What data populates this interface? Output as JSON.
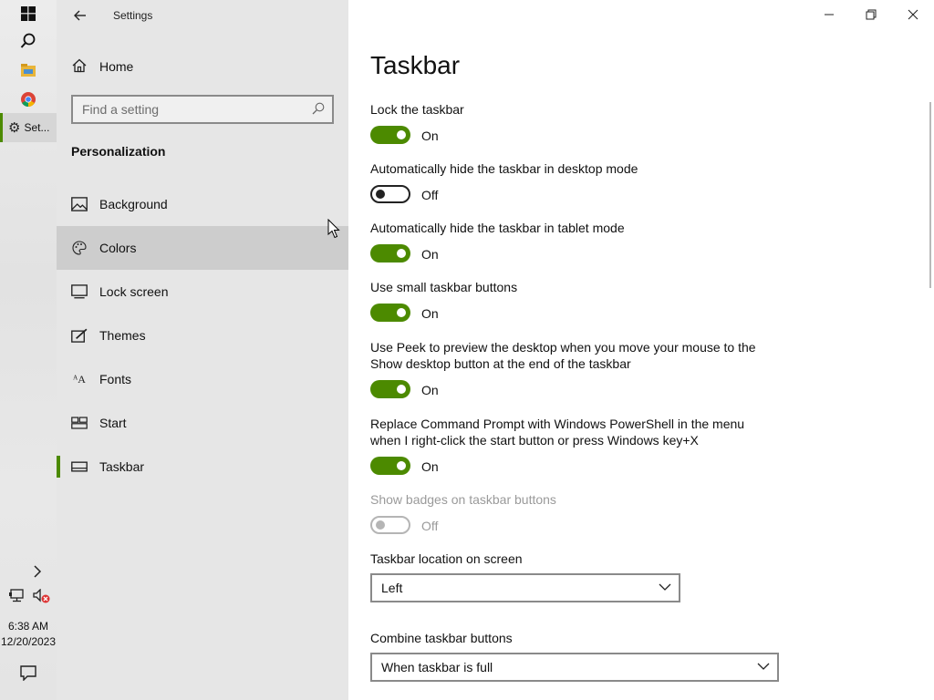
{
  "taskbar": {
    "settings_label": "Set...",
    "time": "6:38 AM",
    "date": "12/20/2023",
    "icons": [
      "windows-logo-icon",
      "search-icon",
      "file-explorer-icon",
      "chrome-icon",
      "gear-icon",
      "chevron-right-icon",
      "network-icon",
      "volume-muted-icon",
      "notification-icon"
    ]
  },
  "nav": {
    "app_title": "Settings",
    "home_label": "Home",
    "search_placeholder": "Find a setting",
    "section_title": "Personalization",
    "items": [
      {
        "label": "Background",
        "icon": "picture-icon"
      },
      {
        "label": "Colors",
        "icon": "palette-icon",
        "state": "hover"
      },
      {
        "label": "Lock screen",
        "icon": "lock-screen-icon"
      },
      {
        "label": "Themes",
        "icon": "brush-icon"
      },
      {
        "label": "Fonts",
        "icon": "font-icon"
      },
      {
        "label": "Start",
        "icon": "start-tiles-icon"
      },
      {
        "label": "Taskbar",
        "icon": "taskbar-icon",
        "state": "selected"
      }
    ]
  },
  "main": {
    "title": "Taskbar",
    "settings": [
      {
        "label": "Lock the taskbar",
        "state": "On",
        "on": true
      },
      {
        "label": "Automatically hide the taskbar in desktop mode",
        "state": "Off",
        "on": false
      },
      {
        "label": "Automatically hide the taskbar in tablet mode",
        "state": "On",
        "on": true
      },
      {
        "label": "Use small taskbar buttons",
        "state": "On",
        "on": true
      },
      {
        "label": "Use Peek to preview the desktop when you move your mouse to the Show desktop button at the end of the taskbar",
        "state": "On",
        "on": true
      },
      {
        "label": "Replace Command Prompt with Windows PowerShell in the menu when I right-click the start button or press Windows key+X",
        "state": "On",
        "on": true
      },
      {
        "label": "Show badges on taskbar buttons",
        "state": "Off",
        "on": false,
        "disabled": true
      }
    ],
    "location_label": "Taskbar location on screen",
    "location_value": "Left",
    "combine_label": "Combine taskbar buttons",
    "combine_value": "When taskbar is full"
  },
  "colors": {
    "accent": "#4c8a00",
    "nav_bg": "#e6e6e6",
    "hover_bg": "#cdcdcd"
  }
}
